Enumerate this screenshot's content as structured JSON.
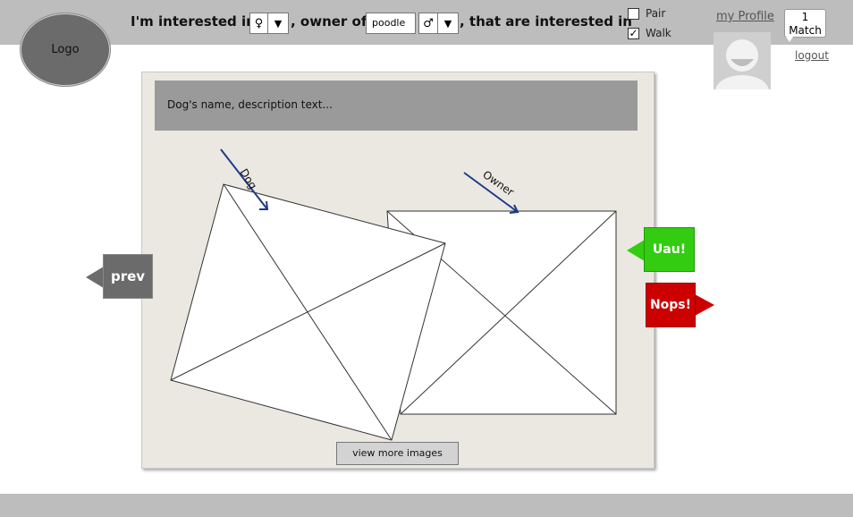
{
  "header": {
    "logo": "Logo",
    "filter_text_1": "I'm interested in",
    "gender_1": "♀",
    "dropdown_arrow": "▼",
    "filter_text_2": ", owner of",
    "breed": "poodle",
    "gender_2": "♂",
    "filter_text_3": ",  that are interested in",
    "options": [
      {
        "label": "Pair",
        "checked": false
      },
      {
        "label": "Walk",
        "checked": true
      }
    ],
    "check_mark": "✓",
    "my_profile": "my Profile",
    "match_count": "1",
    "match_label": "Match",
    "logout": "logout"
  },
  "card": {
    "description": "Dog's name, description text...",
    "dog_label": "Dog",
    "owner_label": "Owner",
    "view_more": "view more images"
  },
  "actions": {
    "prev": "prev",
    "like": "Uau!",
    "dislike": "Nops!"
  },
  "colors": {
    "bar": "#bdbdbd",
    "like": "#33cc11",
    "dislike": "#cc0000",
    "arrow": "#1f3a8a"
  }
}
